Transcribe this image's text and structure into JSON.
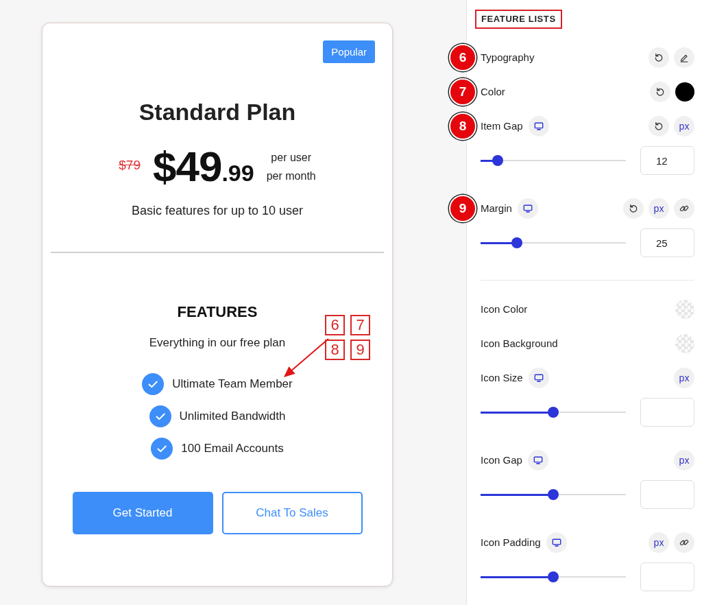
{
  "preview_card": {
    "badge": "Popular",
    "title": "Standard Plan",
    "old_price": "$79",
    "price": "$49",
    "price_cents": ".99",
    "period_lines": [
      "per user",
      "per month"
    ],
    "description": "Basic features for up to 10 user",
    "features_heading": "FEATURES",
    "features_subheading": "Everything in our free plan",
    "features": [
      "Ultimate Team Member",
      "Unlimited Bandwidth",
      "100 Email Accounts"
    ],
    "buttons": [
      {
        "label": "Get Started",
        "kind": "primary"
      },
      {
        "label": "Chat To Sales",
        "kind": "outline"
      }
    ],
    "callout": {
      "labels": [
        "6",
        "7",
        "8",
        "9"
      ]
    }
  },
  "settings_panel": {
    "section_title": "FEATURE LISTS",
    "title_highlighted": true,
    "groups": [
      {
        "controls": [
          {
            "kind": "typography",
            "label": "Typography",
            "marker": "6",
            "responsive": false,
            "reset": true,
            "link": false
          },
          {
            "kind": "color",
            "label": "Color",
            "marker": "7",
            "responsive": false,
            "reset": true,
            "link": false,
            "color": "#000000"
          },
          {
            "kind": "slider",
            "label": "Item Gap",
            "marker": "8",
            "responsive": true,
            "reset": true,
            "unit": "px",
            "link": false,
            "level": 0.12,
            "value": "12"
          },
          {
            "kind": "slider",
            "label": "Margin",
            "marker": "9",
            "responsive": true,
            "reset": true,
            "unit": "px",
            "link": true,
            "level": 0.25,
            "value": "25"
          }
        ]
      },
      {
        "controls": [
          {
            "kind": "color",
            "label": "Icon Color",
            "responsive": false,
            "reset": false,
            "link": false
          },
          {
            "kind": "color",
            "label": "Icon Background",
            "responsive": false,
            "reset": false,
            "link": false
          },
          {
            "kind": "slider",
            "label": "Icon Size",
            "responsive": true,
            "reset": false,
            "unit": "px",
            "link": false,
            "level": 0.5
          },
          {
            "kind": "slider",
            "label": "Icon Gap",
            "responsive": true,
            "reset": false,
            "unit": "px",
            "link": false,
            "level": 0.5
          },
          {
            "kind": "slider",
            "label": "Icon Padding",
            "responsive": true,
            "reset": false,
            "unit": "px",
            "link": true,
            "level": 0.5
          }
        ]
      }
    ]
  }
}
